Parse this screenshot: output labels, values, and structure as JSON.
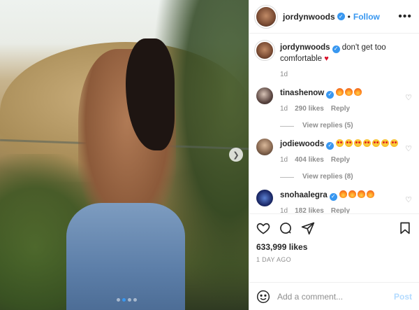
{
  "post": {
    "author": "jordynwoods",
    "follow_label": "Follow",
    "dot_separator": "•",
    "more_icon": "more-horizontal-icon",
    "caption": {
      "user": "jordynwoods",
      "text": "don't get too comfortable",
      "time": "1d"
    },
    "carousel": {
      "current_index": 2,
      "total": 4
    }
  },
  "comments": [
    {
      "user": "tinashenow",
      "emoji_count": 3,
      "emoji_type": "fire",
      "time": "1d",
      "likes": "290 likes",
      "reply_label": "Reply",
      "view_replies": "View replies (5)"
    },
    {
      "user": "jodiewoods",
      "emoji_count": 7,
      "emoji_type": "heart-eyes",
      "time": "1d",
      "likes": "404 likes",
      "reply_label": "Reply",
      "view_replies": "View replies (8)"
    },
    {
      "user": "snohaalegra",
      "emoji_count": 4,
      "emoji_type": "fire",
      "time": "1d",
      "likes": "182 likes",
      "reply_label": "Reply"
    }
  ],
  "likes_count": "633,999 likes",
  "time_ago": "1 DAY AGO",
  "comment_input": {
    "placeholder": "Add a comment...",
    "post_label": "Post"
  },
  "colors": {
    "accent": "#3897f0",
    "post_disabled": "#b3dbff",
    "meta_gray": "#8e8e8e"
  }
}
